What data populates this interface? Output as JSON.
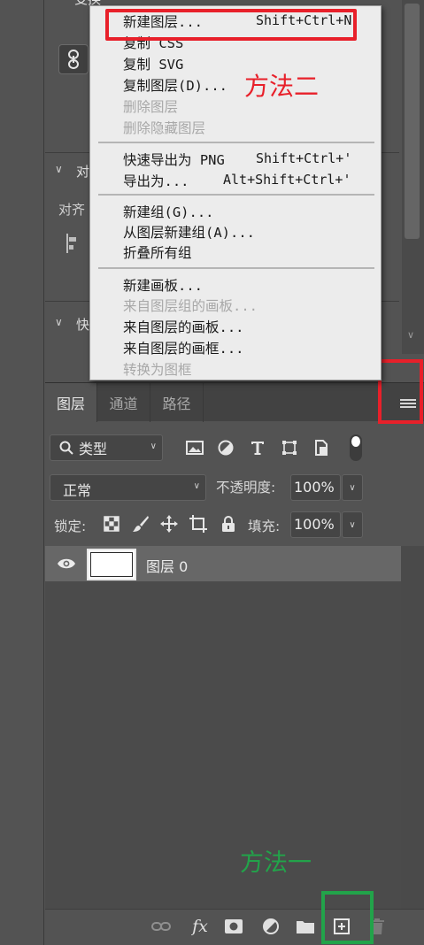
{
  "properties": {
    "title": "变换",
    "align_section": "对",
    "align_label": "对齐",
    "quick_section": "快"
  },
  "context_menu": {
    "items": [
      {
        "label": "新建图层...",
        "shortcut": "Shift+Ctrl+N",
        "disabled": false
      },
      {
        "label": "复制 CSS",
        "shortcut": "",
        "disabled": false
      },
      {
        "label": "复制 SVG",
        "shortcut": "",
        "disabled": false
      },
      {
        "label": "复制图层(D)...",
        "shortcut": "",
        "disabled": false
      },
      {
        "label": "删除图层",
        "shortcut": "",
        "disabled": true
      },
      {
        "label": "删除隐藏图层",
        "shortcut": "",
        "disabled": true
      },
      {
        "label": "快速导出为 PNG",
        "shortcut": "Shift+Ctrl+'",
        "disabled": false
      },
      {
        "label": "导出为...",
        "shortcut": "Alt+Shift+Ctrl+'",
        "disabled": false
      },
      {
        "label": "新建组(G)...",
        "shortcut": "",
        "disabled": false
      },
      {
        "label": "从图层新建组(A)...",
        "shortcut": "",
        "disabled": false
      },
      {
        "label": "折叠所有组",
        "shortcut": "",
        "disabled": false
      },
      {
        "label": "新建画板...",
        "shortcut": "",
        "disabled": false
      },
      {
        "label": "来自图层组的画板...",
        "shortcut": "",
        "disabled": true
      },
      {
        "label": "来自图层的画板...",
        "shortcut": "",
        "disabled": false
      },
      {
        "label": "来自图层的画框...",
        "shortcut": "",
        "disabled": false
      },
      {
        "label": "转换为图框",
        "shortcut": "",
        "disabled": true
      }
    ]
  },
  "annotations": {
    "method_two": "方法二",
    "method_one": "方法一",
    "red": "#e8202a",
    "green": "#22a34a"
  },
  "layers_panel": {
    "tabs": [
      "图层",
      "通道",
      "路径"
    ],
    "active_tab": "图层",
    "filter_kind": "类型",
    "blend_mode": "正常",
    "opacity_label": "不透明度:",
    "opacity_value": "100%",
    "lock_label": "锁定:",
    "fill_label": "填充:",
    "fill_value": "100%",
    "layers": [
      {
        "name": "图层 0",
        "visible": true
      }
    ],
    "bottom_icons": [
      "link-icon",
      "fx-icon",
      "mask-icon",
      "adjustment-icon",
      "folder-icon",
      "new-layer-icon",
      "trash-icon"
    ],
    "fx_label": "fx"
  }
}
